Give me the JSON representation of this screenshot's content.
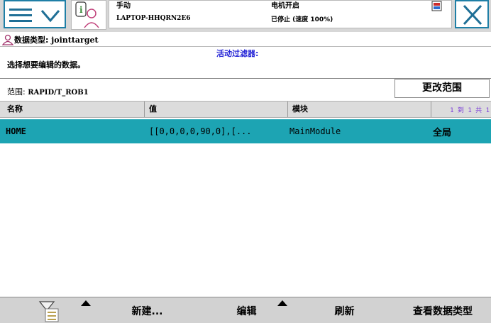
{
  "header": {
    "mode": "手动",
    "controller": "LAPTOP-HHQRN2E6",
    "motor_state": "电机开启",
    "run_state": "已停止 (速度 100%)"
  },
  "datatype": {
    "label": "数据类型:",
    "value": "jointtarget"
  },
  "hint": "选择想要编辑的数据。",
  "filter_label": "活动过滤器:",
  "scope": {
    "label": "范围:",
    "value": "RAPID/T_ROB1",
    "change_button": "更改范围"
  },
  "table": {
    "columns": [
      "名称",
      "值",
      "模块"
    ],
    "paging": "1 到 1 共 1",
    "rows": [
      {
        "name": "HOME",
        "value": "[[0,0,0,0,90,0],[...",
        "module": "MainModule",
        "scope": "全局"
      }
    ]
  },
  "toolbar": {
    "new": "新建...",
    "edit": "编辑",
    "refresh": "刷新",
    "view_type": "查看数据类型"
  },
  "colors": {
    "accent_border": "#1f7fa6",
    "selected_row": "#1da4b3",
    "filter_text": "#2323d6"
  },
  "icons": [
    "menu-icon",
    "chevron-down-icon",
    "user-info-icon",
    "status-icon",
    "close-icon",
    "filter-icon",
    "user-icon"
  ]
}
